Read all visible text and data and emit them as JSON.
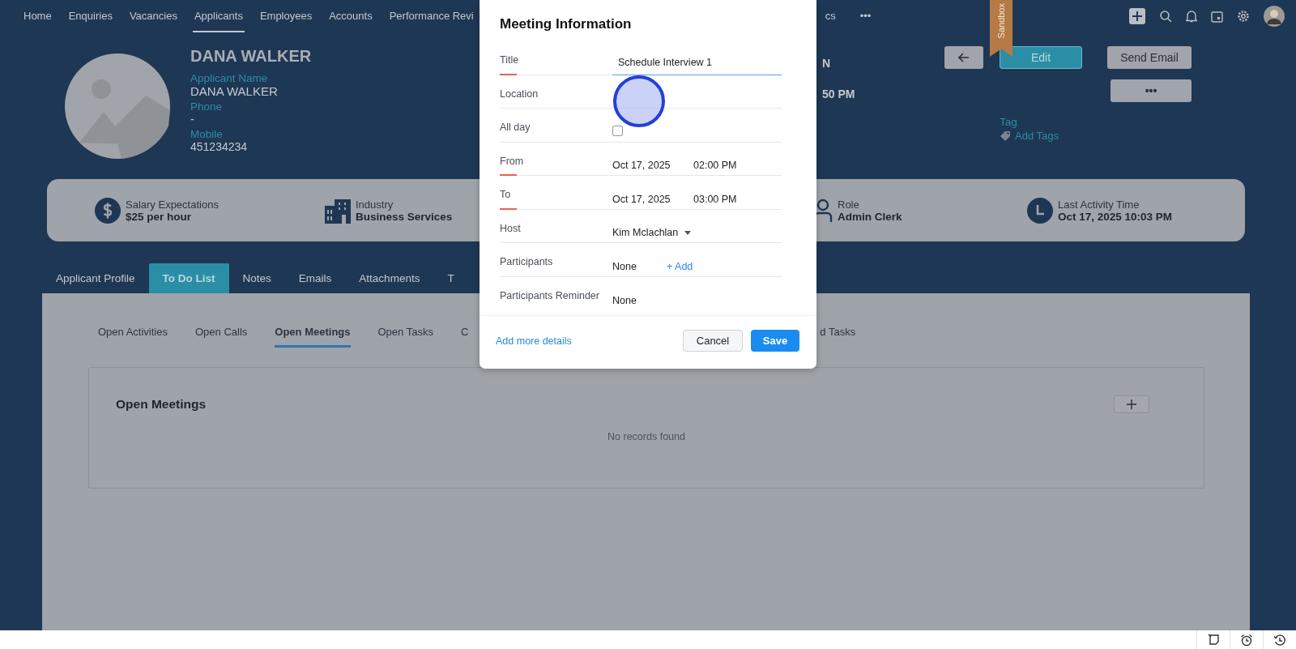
{
  "top_nav": {
    "left_items": [
      {
        "label": "Home",
        "selected": false
      },
      {
        "label": "Enquiries",
        "selected": false
      },
      {
        "label": "Vacancies",
        "selected": false
      },
      {
        "label": "Applicants",
        "selected": true
      },
      {
        "label": "Employees",
        "selected": false
      },
      {
        "label": "Accounts",
        "selected": false
      },
      {
        "label": "Performance Revi",
        "selected": false
      }
    ],
    "right_items": [
      {
        "label": "cs",
        "selected": false
      }
    ],
    "more": "•••"
  },
  "ribbon": "Sandbox",
  "profile": {
    "name": "DANA WALKER",
    "fields": [
      {
        "label": "Applicant Name",
        "value": "DANA WALKER"
      },
      {
        "label": "Phone",
        "value": "-"
      },
      {
        "label": "Mobile",
        "value": "451234234"
      }
    ],
    "partial_texts": [
      "N",
      "50 PM"
    ],
    "edit": "Edit",
    "send_email": "Send Email",
    "more": "•••",
    "tag_label": "Tag",
    "add_tags": "Add Tags"
  },
  "info_card": [
    {
      "kind": "salary",
      "label": "Salary Expectations",
      "value": "$25 per hour"
    },
    {
      "kind": "industry",
      "label": "Industry",
      "value": "Business Services"
    },
    {
      "kind": "role",
      "label": "Role",
      "value": "Admin Clerk"
    },
    {
      "kind": "clock",
      "label": "Last Activity Time",
      "value": "Oct 17, 2025 10:03 PM"
    }
  ],
  "tabs": [
    {
      "label": "Applicant Profile",
      "selected": false
    },
    {
      "label": "To Do List",
      "selected": true
    },
    {
      "label": "Notes",
      "selected": false
    },
    {
      "label": "Emails",
      "selected": false
    },
    {
      "label": "Attachments",
      "selected": false
    },
    {
      "label": "T",
      "selected": false
    }
  ],
  "subtabs": {
    "left": [
      {
        "label": "Open Activities",
        "selected": false
      },
      {
        "label": "Open Calls",
        "selected": false
      },
      {
        "label": "Open Meetings",
        "selected": true
      },
      {
        "label": "Open Tasks",
        "selected": false
      },
      {
        "label": "C",
        "selected": false
      }
    ],
    "right": [
      {
        "label": "d Tasks",
        "selected": false
      }
    ]
  },
  "section": {
    "title": "Open Meetings",
    "empty": "No records found"
  },
  "modal": {
    "title": "Meeting Information",
    "rows": [
      {
        "kind": "text",
        "label": "Title",
        "required": true,
        "value": "Schedule Interview 1",
        "focused": true
      },
      {
        "kind": "text",
        "label": "Location",
        "required": false,
        "focused": false
      },
      {
        "kind": "checkbox",
        "label": "All day",
        "required": false,
        "checked": false
      },
      {
        "kind": "datetime",
        "label": "From",
        "required": true,
        "date": "Oct 17, 2025",
        "time": "02:00 PM"
      },
      {
        "kind": "datetime",
        "label": "To",
        "required": true,
        "date": "Oct 17, 2025",
        "time": "03:00 PM"
      },
      {
        "kind": "select",
        "label": "Host",
        "required": false,
        "value": "Kim Mclachlan"
      },
      {
        "kind": "participants",
        "label": "Participants",
        "required": false,
        "value": "None",
        "action": "+ Add"
      },
      {
        "kind": "select_plain",
        "label": "Participants Reminder",
        "required": false,
        "value": "None"
      }
    ],
    "more_link": "Add more details",
    "cancel": "Cancel",
    "save": "Save"
  }
}
